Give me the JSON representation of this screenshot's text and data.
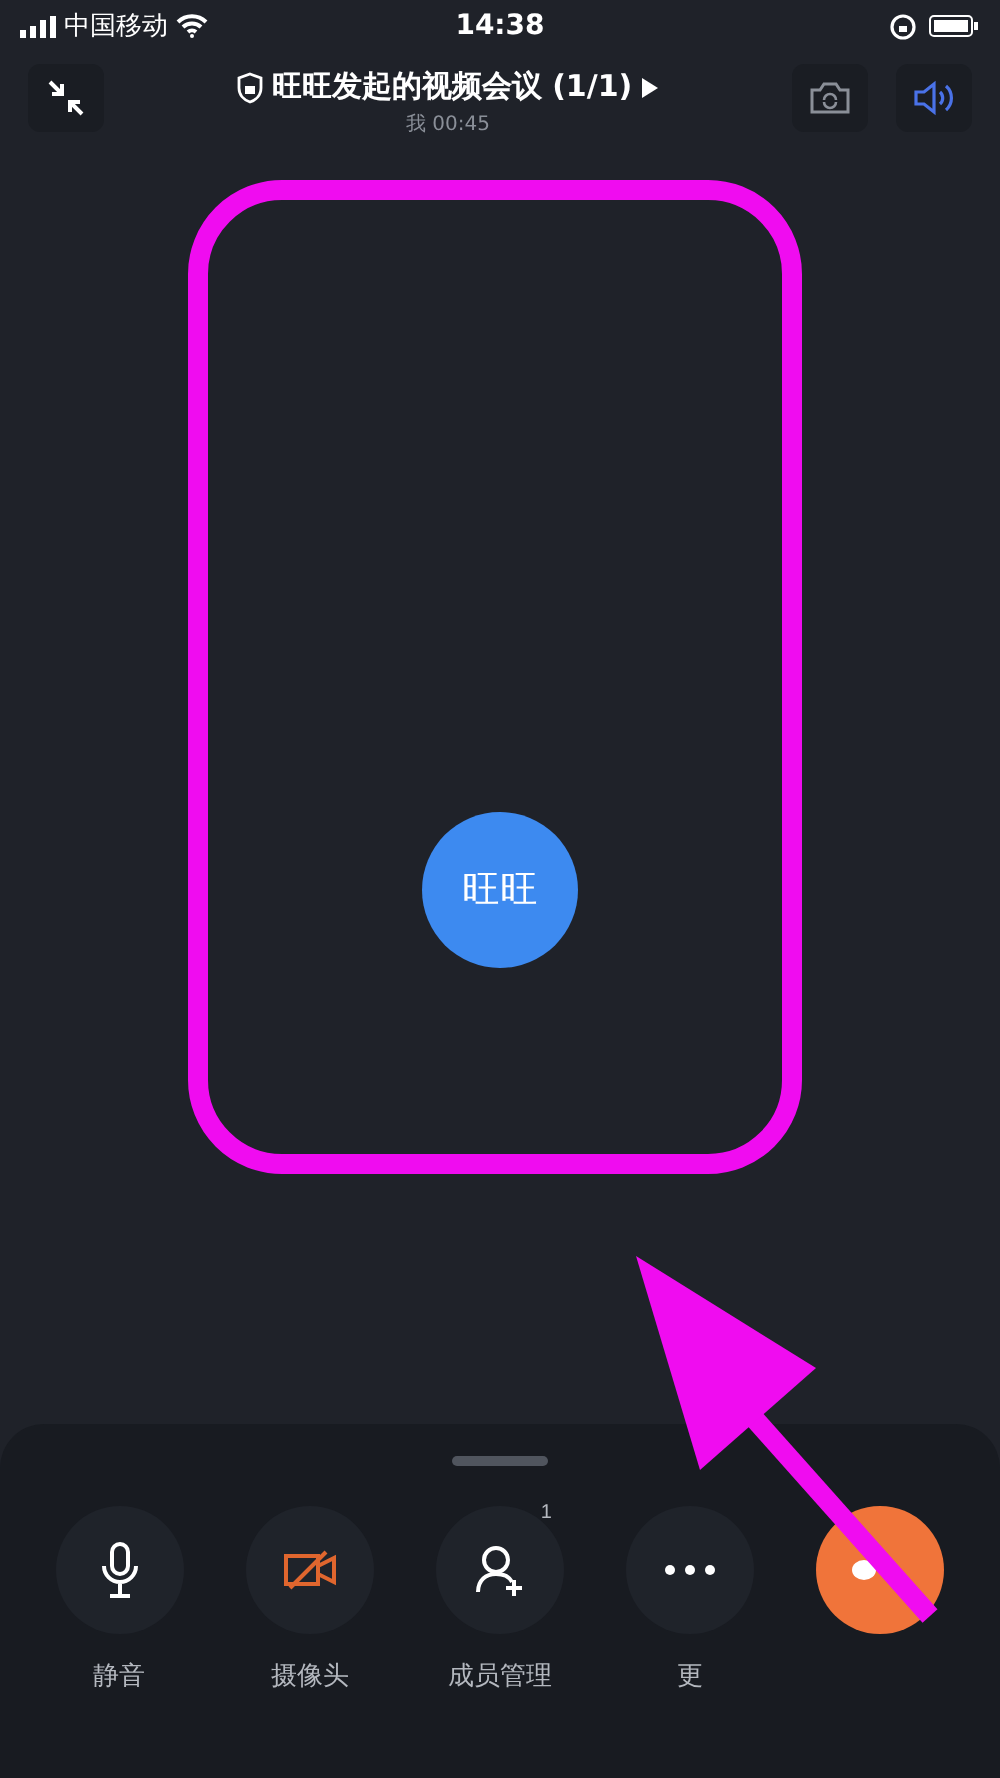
{
  "status_bar": {
    "carrier": "中国移动",
    "time": "14:38"
  },
  "header": {
    "title": "旺旺发起的视频会议 (1/1)",
    "subtitle": "我 00:45"
  },
  "participant": {
    "name": "旺旺"
  },
  "controls": [
    {
      "kind": "mic",
      "label": "静音"
    },
    {
      "kind": "camera",
      "label": "摄像头",
      "off": true
    },
    {
      "kind": "members",
      "label": "成员管理",
      "badge": "1"
    },
    {
      "kind": "more",
      "label": "更"
    },
    {
      "kind": "hangup"
    }
  ]
}
